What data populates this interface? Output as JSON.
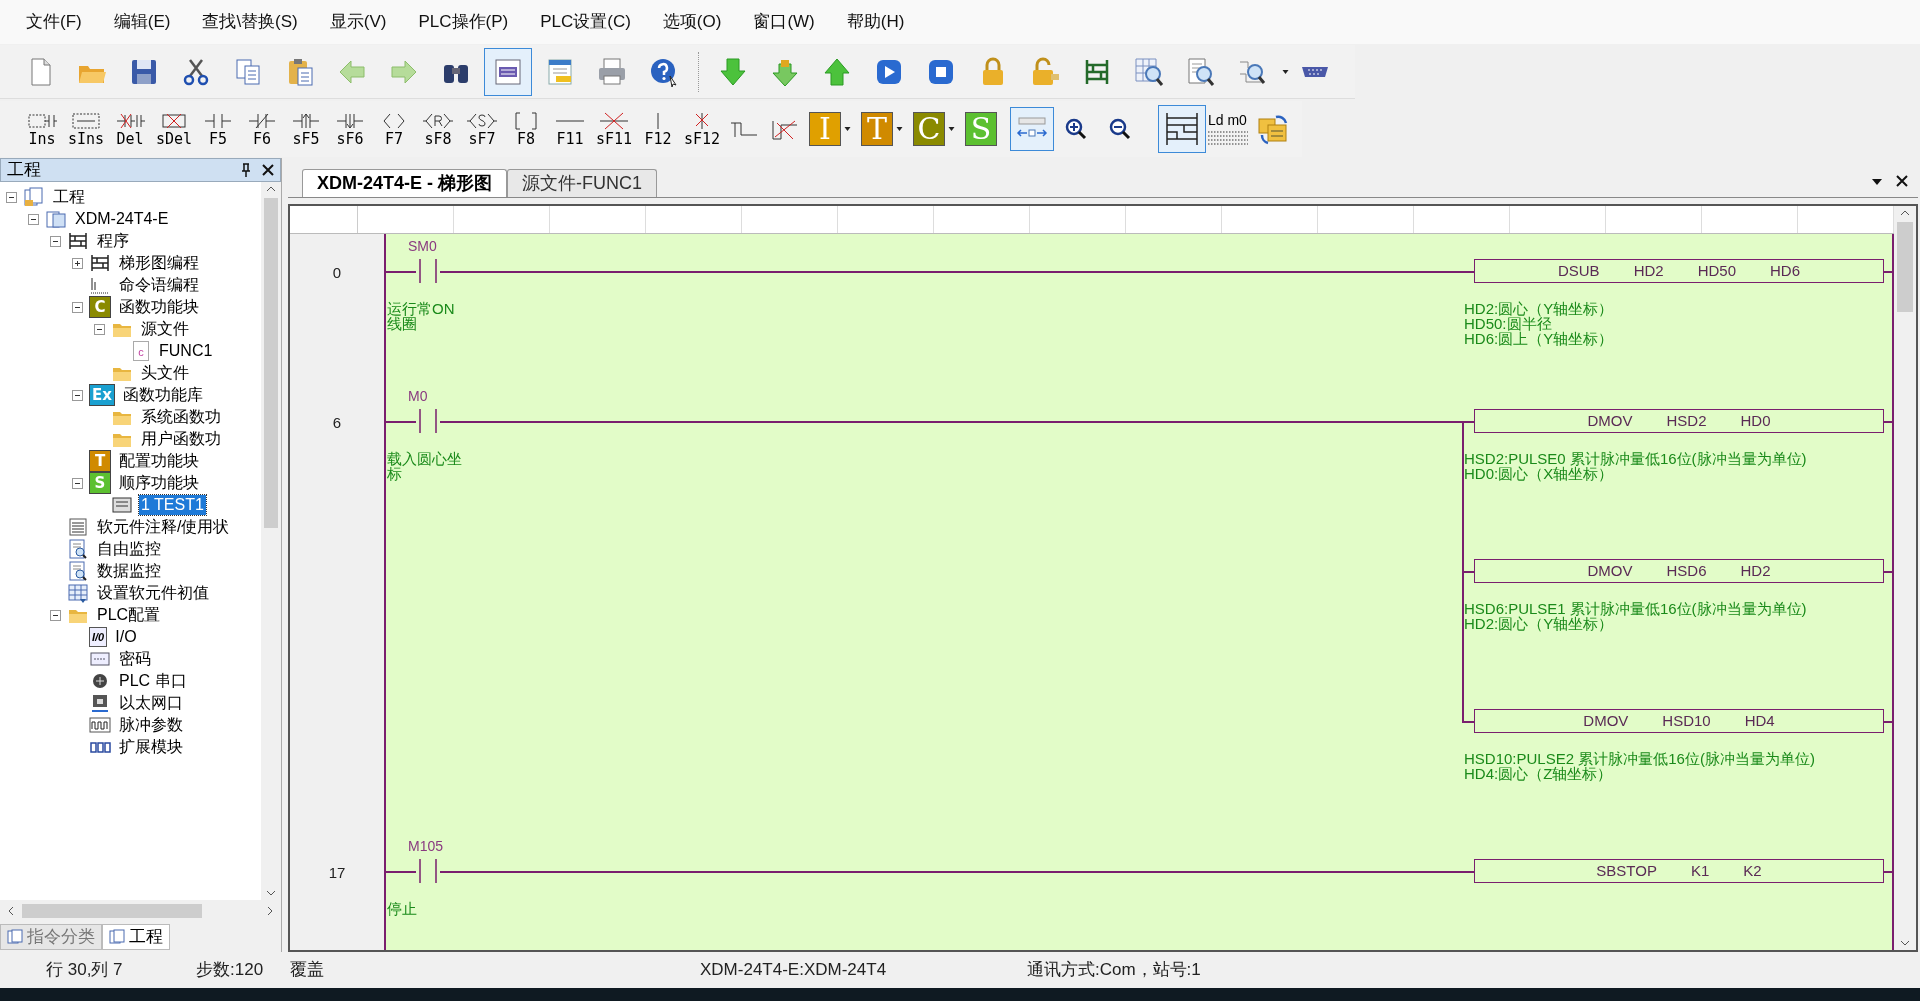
{
  "menu": [
    "文件(F)",
    "编辑(E)",
    "查找\\替换(S)",
    "显示(V)",
    "PLC操作(P)",
    "PLC设置(C)",
    "选项(O)",
    "窗口(W)",
    "帮助(H)"
  ],
  "main_toolbar": [
    {
      "kind": "new",
      "pressed": false
    },
    {
      "kind": "open",
      "pressed": false
    },
    {
      "kind": "save",
      "pressed": false
    },
    {
      "kind": "cut",
      "pressed": false
    },
    {
      "kind": "copy",
      "pressed": false
    },
    {
      "kind": "paste",
      "pressed": false
    },
    {
      "kind": "back",
      "pressed": false
    },
    {
      "kind": "forward",
      "pressed": false
    },
    {
      "kind": "find",
      "pressed": false
    },
    {
      "kind": "monitor",
      "pressed": true
    },
    {
      "kind": "window",
      "pressed": false
    },
    {
      "kind": "print",
      "pressed": false
    },
    {
      "kind": "help",
      "pressed": false
    },
    {
      "kind": "sep"
    },
    {
      "kind": "download",
      "pressed": false
    },
    {
      "kind": "download-lock",
      "pressed": false
    },
    {
      "kind": "upload",
      "pressed": false
    },
    {
      "kind": "run",
      "pressed": false
    },
    {
      "kind": "stop",
      "pressed": false
    },
    {
      "kind": "lock",
      "pressed": false
    },
    {
      "kind": "unlock",
      "pressed": false
    },
    {
      "kind": "ladder",
      "pressed": false
    },
    {
      "kind": "table-search",
      "pressed": false
    },
    {
      "kind": "doc-search",
      "pressed": false
    },
    {
      "kind": "diagram-search",
      "pressed": false
    },
    {
      "kind": "serial",
      "pressed": false
    }
  ],
  "ladder_toolbar": [
    {
      "kind": "ins",
      "label": "Ins"
    },
    {
      "kind": "sins",
      "label": "sIns"
    },
    {
      "kind": "del",
      "label": "Del"
    },
    {
      "kind": "sdel",
      "label": "sDel"
    },
    {
      "kind": "no",
      "label": "F5"
    },
    {
      "kind": "nc",
      "label": "F6"
    },
    {
      "kind": "pos",
      "label": "sF5"
    },
    {
      "kind": "neg",
      "label": "sF6"
    },
    {
      "kind": "coil",
      "label": "F7"
    },
    {
      "kind": "reset",
      "label": "sF8"
    },
    {
      "kind": "set",
      "label": "sF7"
    },
    {
      "kind": "func",
      "label": "F8"
    },
    {
      "kind": "hline",
      "label": "F11"
    },
    {
      "kind": "hdel",
      "label": "sF11"
    },
    {
      "kind": "vline",
      "label": "F12"
    },
    {
      "kind": "vdel",
      "label": "sF12"
    },
    {
      "kind": "step-up"
    },
    {
      "kind": "step-del"
    },
    {
      "kind": "letter",
      "label": "I",
      "color": "#e0a000",
      "dropdown": true
    },
    {
      "kind": "letter",
      "label": "T",
      "color": "#d08a00",
      "dropdown": true
    },
    {
      "kind": "letter",
      "label": "C",
      "color": "#8a8a00",
      "dropdown": true
    },
    {
      "kind": "letter",
      "label": "S",
      "color": "#5cc030",
      "dropdown": false
    },
    {
      "kind": "fit",
      "pressed": true
    },
    {
      "kind": "zoom-in",
      "pressed": false
    },
    {
      "kind": "zoom-out",
      "pressed": false
    },
    {
      "kind": "ladder-view",
      "pressed": true
    },
    {
      "kind": "list",
      "label": "Ld m0"
    },
    {
      "kind": "convert"
    }
  ],
  "project_panel": {
    "title": "工程",
    "tree": [
      {
        "label": "工程",
        "kind": "project",
        "selected": false,
        "expanded": true,
        "children": [
          {
            "label": "XDM-24T4-E",
            "kind": "device",
            "selected": false,
            "expanded": true,
            "children": [
              {
                "label": "程序",
                "kind": "program",
                "selected": false,
                "expanded": true,
                "children": [
                  {
                    "label": "梯形图编程",
                    "kind": "program",
                    "selected": false,
                    "expanded": false
                  },
                  {
                    "label": "命令语编程",
                    "kind": "command",
                    "selected": false
                  },
                  {
                    "label": "函数功能块",
                    "kind": "badge",
                    "badge": "C",
                    "color": "#8a8a00",
                    "selected": false,
                    "expanded": true,
                    "children": [
                      {
                        "label": "源文件",
                        "kind": "folder",
                        "selected": false,
                        "expanded": true,
                        "children": [
                          {
                            "label": "FUNC1",
                            "kind": "c-file",
                            "badge": "c",
                            "selected": false
                          }
                        ]
                      },
                      {
                        "label": "头文件",
                        "kind": "folder",
                        "selected": false
                      }
                    ]
                  },
                  {
                    "label": "函数功能库",
                    "kind": "badge",
                    "badge": "Ex",
                    "color": "#1aa0d0",
                    "selected": false,
                    "expanded": true,
                    "children": [
                      {
                        "label": "系统函数功",
                        "kind": "folder",
                        "selected": false
                      },
                      {
                        "label": "用户函数功",
                        "kind": "folder",
                        "selected": false
                      }
                    ]
                  },
                  {
                    "label": "配置功能块",
                    "kind": "badge",
                    "badge": "T",
                    "color": "#d08a00",
                    "selected": false
                  },
                  {
                    "label": "顺序功能块",
                    "kind": "badge",
                    "badge": "S",
                    "color": "#5cc030",
                    "selected": false,
                    "expanded": true,
                    "children": [
                      {
                        "label": "1 TEST1",
                        "kind": "sfc",
                        "selected": true
                      }
                    ]
                  }
                ]
              },
              {
                "label": "软元件注释/使用状",
                "kind": "list",
                "selected": false
              },
              {
                "label": "自由监控",
                "kind": "monitor",
                "selected": false
              },
              {
                "label": "数据监控",
                "kind": "monitor",
                "selected": false
              },
              {
                "label": "设置软元件初值",
                "kind": "grid",
                "selected": false
              },
              {
                "label": "PLC配置",
                "kind": "folder",
                "selected": false,
                "expanded": true,
                "children": [
                  {
                    "label": "I/O",
                    "kind": "io",
                    "badge": "I/0",
                    "selected": false
                  },
                  {
                    "label": "密码",
                    "kind": "password",
                    "selected": false
                  },
                  {
                    "label": "PLC 串口",
                    "kind": "serial",
                    "selected": false
                  },
                  {
                    "label": "以太网口",
                    "kind": "ethernet",
                    "selected": false
                  },
                  {
                    "label": "脉冲参数",
                    "kind": "pulse",
                    "selected": false
                  },
                  {
                    "label": "扩展模块",
                    "kind": "expansion",
                    "selected": false
                  }
                ]
              }
            ]
          }
        ]
      }
    ],
    "tabs": [
      {
        "label": "指令分类",
        "selected": false
      },
      {
        "label": "工程",
        "selected": true
      }
    ]
  },
  "editor_tabs": [
    {
      "label": "XDM-24T4-E - 梯形图",
      "selected": true
    },
    {
      "label": "源文件-FUNC1",
      "selected": false
    }
  ],
  "ladder": {
    "rungs": [
      {
        "step": "0",
        "contact": "SM0",
        "comment": [
          "运行常ON",
          "线圈"
        ],
        "outputs": [
          {
            "operands": [
              "DSUB",
              "HD2",
              "HD50",
              "HD6"
            ],
            "comment": [
              "HD2:圆心（Y轴坐标）",
              "HD50:圆半径",
              "HD6:圆上（Y轴坐标）"
            ]
          }
        ]
      },
      {
        "step": "6",
        "contact": "M0",
        "comment": [
          "载入圆心坐",
          "标"
        ],
        "outputs": [
          {
            "operands": [
              "DMOV",
              "HSD2",
              "HD0"
            ],
            "comment": [
              "HSD2:PULSE0 累计脉冲量低16位(脉冲当量为单位)",
              "HD0:圆心（X轴坐标）"
            ]
          },
          {
            "operands": [
              "DMOV",
              "HSD6",
              "HD2"
            ],
            "comment": [
              "HSD6:PULSE1 累计脉冲量低16位(脉冲当量为单位)",
              "HD2:圆心（Y轴坐标）"
            ]
          },
          {
            "operands": [
              "DMOV",
              "HSD10",
              "HD4"
            ],
            "comment": [
              "HSD10:PULSE2 累计脉冲量低16位(脉冲当量为单位)",
              "HD4:圆心（Z轴坐标）"
            ]
          }
        ]
      },
      {
        "step": "17",
        "contact": "M105",
        "comment": [
          "停止"
        ],
        "outputs": [
          {
            "operands": [
              "SBSTOP",
              "K1",
              "K2"
            ]
          }
        ]
      }
    ]
  },
  "status_bar": {
    "position": "行 30,列 7",
    "steps": "步数:120",
    "mode": "覆盖",
    "device": "XDM-24T4-E:XDM-24T4",
    "comm": "通讯方式:Com，站号:1"
  }
}
